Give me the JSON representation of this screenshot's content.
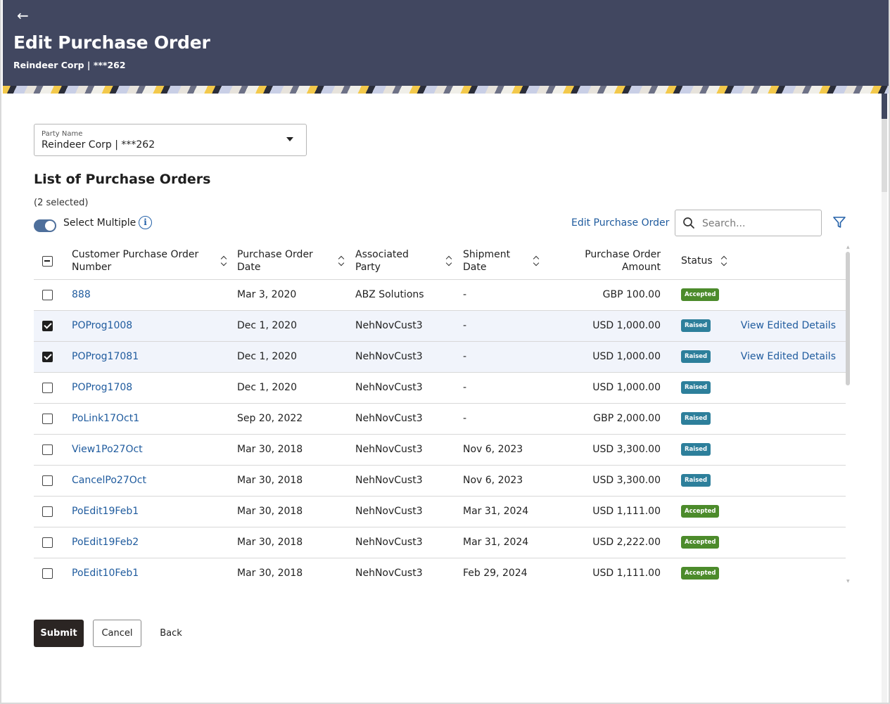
{
  "header": {
    "title": "Edit Purchase Order",
    "subtitle": "Reindeer Corp | ***262"
  },
  "party": {
    "label": "Party Name",
    "value": "Reindeer Corp | ***262"
  },
  "list": {
    "title": "List of Purchase Orders",
    "selected_count": "(2 selected)",
    "select_multiple_label": "Select Multiple",
    "select_multiple_on": true,
    "edit_link": "Edit Purchase Order",
    "search_placeholder": "Search..."
  },
  "table": {
    "columns": {
      "po_number": "Customer Purchase Order Number",
      "po_date": "Purchase Order Date",
      "party": "Associated Party",
      "ship_date": "Shipment Date",
      "amount": "Purchase Order Amount",
      "status": "Status"
    },
    "rows": [
      {
        "checked": false,
        "po_number": "888",
        "po_date": "Mar 3, 2020",
        "party": "ABZ Solutions",
        "ship_date": "-",
        "amount": "GBP 100.00",
        "status": "Accepted",
        "action": ""
      },
      {
        "checked": true,
        "po_number": "POProg1008",
        "po_date": "Dec 1, 2020",
        "party": "NehNovCust3",
        "ship_date": "-",
        "amount": "USD 1,000.00",
        "status": "Raised",
        "action": "View Edited Details"
      },
      {
        "checked": true,
        "po_number": "POProg17081",
        "po_date": "Dec 1, 2020",
        "party": "NehNovCust3",
        "ship_date": "-",
        "amount": "USD 1,000.00",
        "status": "Raised",
        "action": "View Edited Details"
      },
      {
        "checked": false,
        "po_number": "POProg1708",
        "po_date": "Dec 1, 2020",
        "party": "NehNovCust3",
        "ship_date": "-",
        "amount": "USD 1,000.00",
        "status": "Raised",
        "action": ""
      },
      {
        "checked": false,
        "po_number": "PoLink17Oct1",
        "po_date": "Sep 20, 2022",
        "party": "NehNovCust3",
        "ship_date": "-",
        "amount": "GBP 2,000.00",
        "status": "Raised",
        "action": ""
      },
      {
        "checked": false,
        "po_number": "View1Po27Oct",
        "po_date": "Mar 30, 2018",
        "party": "NehNovCust3",
        "ship_date": "Nov 6, 2023",
        "amount": "USD 3,300.00",
        "status": "Raised",
        "action": ""
      },
      {
        "checked": false,
        "po_number": "CancelPo27Oct",
        "po_date": "Mar 30, 2018",
        "party": "NehNovCust3",
        "ship_date": "Nov 6, 2023",
        "amount": "USD 3,300.00",
        "status": "Raised",
        "action": ""
      },
      {
        "checked": false,
        "po_number": "PoEdit19Feb1",
        "po_date": "Mar 30, 2018",
        "party": "NehNovCust3",
        "ship_date": "Mar 31, 2024",
        "amount": "USD 1,111.00",
        "status": "Accepted",
        "action": ""
      },
      {
        "checked": false,
        "po_number": "PoEdit19Feb2",
        "po_date": "Mar 30, 2018",
        "party": "NehNovCust3",
        "ship_date": "Mar 31, 2024",
        "amount": "USD 2,222.00",
        "status": "Accepted",
        "action": ""
      },
      {
        "checked": false,
        "po_number": "PoEdit10Feb1",
        "po_date": "Mar 30, 2018",
        "party": "NehNovCust3",
        "ship_date": "Feb 29, 2024",
        "amount": "USD 1,111.00",
        "status": "Accepted",
        "action": ""
      }
    ]
  },
  "buttons": {
    "submit": "Submit",
    "cancel": "Cancel",
    "back": "Back"
  },
  "icons": {
    "back": "arrow-left-icon",
    "info": "info-icon",
    "search": "search-icon",
    "filter": "filter-icon",
    "dropdown": "chevron-down-icon",
    "sort": "sort-icon"
  },
  "colors": {
    "header_bg": "#414760",
    "link": "#1f5b9e",
    "accepted": "#4c8b2b",
    "raised": "#2d7f9b",
    "primary_button": "#2b2523"
  }
}
